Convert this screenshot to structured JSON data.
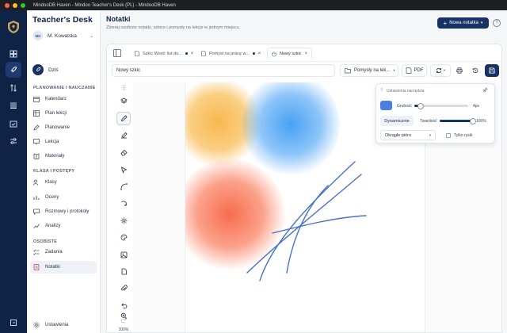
{
  "window": {
    "title": "MindooDB Haven - Mindoo Teacher's Desk (PL) - MindooDB Haven"
  },
  "colors": {
    "navy": "#0f2346",
    "accent": "#173363",
    "brush": "#4a7ee0",
    "stroke": "#4a72c4"
  },
  "rail": {
    "icons": [
      "logo-shield-icon",
      "dashboard-icon",
      "rocket-icon",
      "transfer-icon",
      "library-icon",
      "calendar-check-icon",
      "sliders-icon",
      "logout-icon"
    ]
  },
  "sidebar": {
    "brand": "Teacher's Desk",
    "user": {
      "initials": "MK",
      "name": "M. Kowalska"
    },
    "today": "Dziś",
    "sections": {
      "planning": "PLANOWANIE I NAUCZANIE",
      "classes": "KLASA I POSTĘPY",
      "personal": "OSOBISTE"
    },
    "planning_items": [
      "Kalendarz",
      "Plan lekcji",
      "Planowanie",
      "Lekcja",
      "Materiały"
    ],
    "class_items": [
      "Klasy",
      "Oceny",
      "Rozmowy i protokoły",
      "Analizy"
    ],
    "personal_items": [
      "Zadania",
      "Notatki"
    ],
    "active_item": "Notatki",
    "settings": "Ustawienia"
  },
  "header": {
    "title": "Notatki",
    "subtitle": "Zbieraj osobiste notatki, szkice i pomysły na lekcje w jednym miejscu.",
    "new_button": "Nowa notatka",
    "help": "?"
  },
  "tabs": [
    {
      "label": "Szkic Word: list do...",
      "modified": true,
      "active": false
    },
    {
      "label": "Pomysł na pracę w...",
      "modified": true,
      "active": false
    },
    {
      "label": "Nowy szkic",
      "modified": false,
      "active": true
    }
  ],
  "toolbar": {
    "doc_name": "Nowy szkic",
    "category": "Pomysły na lek...",
    "pdf": "PDF"
  },
  "tools": {
    "zoom": "100%"
  },
  "tool_settings": {
    "title": "Ustawienia narzędzia",
    "thickness_label": "Grubość",
    "thickness_value": "4px",
    "thickness_fraction": 0.12,
    "dynamic_label": "Dynamicznie",
    "hardness_label": "Twardość",
    "hardness_value": "100%",
    "hardness_fraction": 1.0,
    "pen_shape": "Okrągłe pióro",
    "only_pen_label": "Tylko rysik",
    "only_pen_checked": false
  }
}
